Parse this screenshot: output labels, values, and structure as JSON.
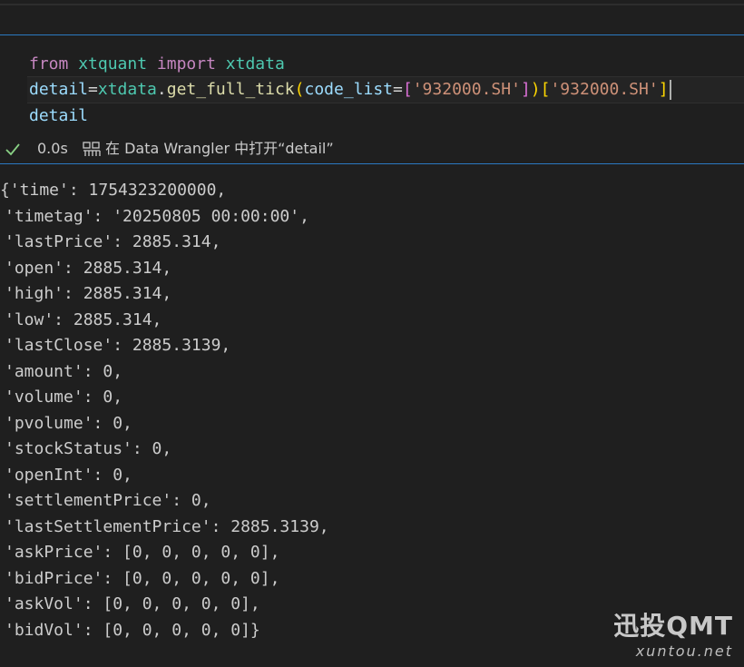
{
  "code_cell": {
    "lines": [
      {
        "tokens": [
          {
            "text": "from",
            "class": "kw"
          },
          {
            "text": " ",
            "class": "op"
          },
          {
            "text": "xtquant",
            "class": "mod"
          },
          {
            "text": " ",
            "class": "op"
          },
          {
            "text": "import",
            "class": "kw"
          },
          {
            "text": " ",
            "class": "op"
          },
          {
            "text": "xtdata",
            "class": "mod"
          }
        ]
      },
      {
        "tokens": [
          {
            "text": "detail",
            "class": "var"
          },
          {
            "text": "=",
            "class": "op"
          },
          {
            "text": "xtdata",
            "class": "mod"
          },
          {
            "text": ".",
            "class": "op"
          },
          {
            "text": "get_full_tick",
            "class": "fn"
          },
          {
            "text": "(",
            "class": "br1"
          },
          {
            "text": "code_list",
            "class": "var"
          },
          {
            "text": "=",
            "class": "op"
          },
          {
            "text": "[",
            "class": "br2"
          },
          {
            "text": "'932000.SH'",
            "class": "str"
          },
          {
            "text": "]",
            "class": "br2"
          },
          {
            "text": ")",
            "class": "br1"
          },
          {
            "text": "[",
            "class": "br1"
          },
          {
            "text": "'932000.SH'",
            "class": "str"
          },
          {
            "text": "]",
            "class": "br1"
          }
        ]
      },
      {
        "tokens": [
          {
            "text": "detail",
            "class": "var"
          }
        ]
      }
    ]
  },
  "status": {
    "check_icon": "check-icon",
    "exec_time": "0.0s",
    "wrangler_icon": "data-wrangler-icon",
    "wrangler_label": "在 Data Wrangler 中打开“detail”"
  },
  "output": {
    "lines": [
      "{'time': 1754323200000,",
      "'timetag': '20250805 00:00:00',",
      "'lastPrice': 2885.314,",
      "'open': 2885.314,",
      "'high': 2885.314,",
      "'low': 2885.314,",
      "'lastClose': 2885.3139,",
      "'amount': 0,",
      "'volume': 0,",
      "'pvolume': 0,",
      "'stockStatus': 0,",
      "'openInt': 0,",
      "'settlementPrice': 0,",
      "'lastSettlementPrice': 2885.3139,",
      "'askPrice': [0, 0, 0, 0, 0],",
      "'bidPrice': [0, 0, 0, 0, 0],",
      "'askVol': [0, 0, 0, 0, 0],",
      "'bidVol': [0, 0, 0, 0, 0]}"
    ]
  },
  "watermark": {
    "title": "迅投QMT",
    "subtitle": "xuntou.net"
  },
  "colors": {
    "background": "#1f1f1f",
    "cell_border": "#2b79c2",
    "keyword": "#c586c0",
    "module": "#4ec9b0",
    "variable": "#9cdcfe",
    "function": "#dcdcaa",
    "string": "#ce9178",
    "check": "#89d185"
  }
}
